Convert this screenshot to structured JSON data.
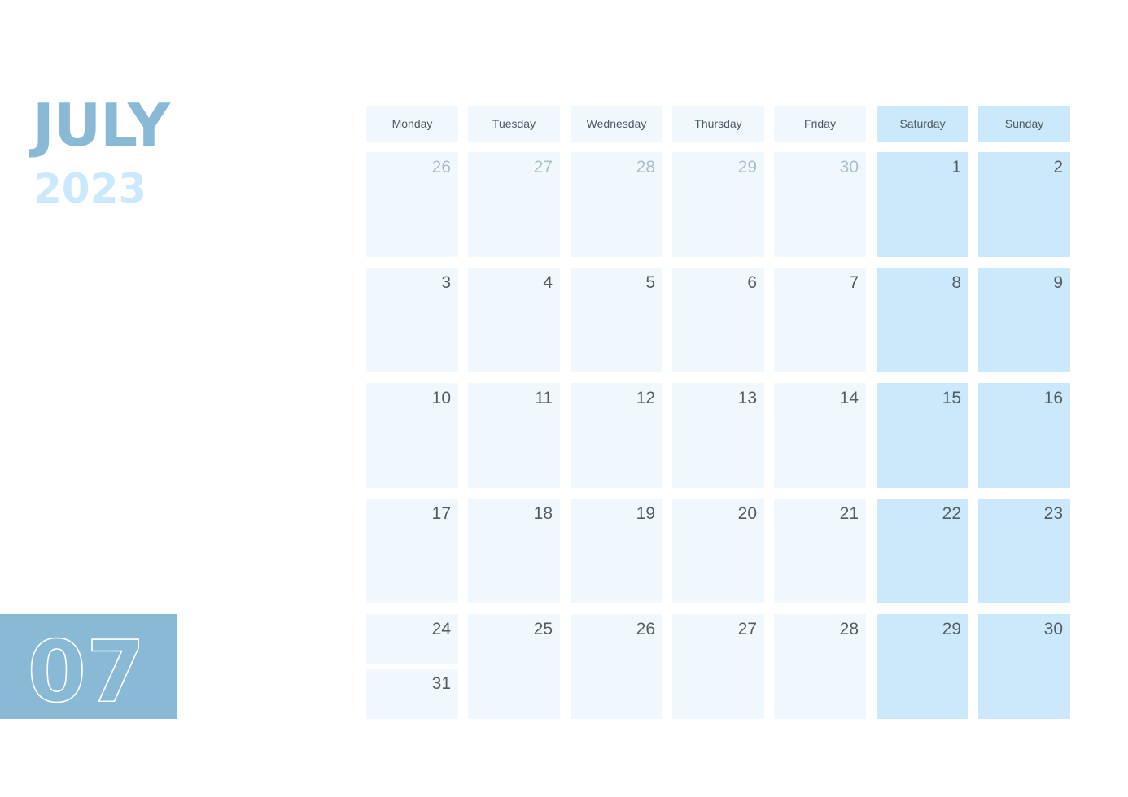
{
  "calendar": {
    "month_name": "JULY",
    "year": "2023",
    "month_number": "07",
    "colors": {
      "title": "#8ab9d6",
      "year": "#cbe9fa",
      "weekday_cell": "#f1f8fd",
      "weekend_cell": "#cbe9fa",
      "month_box": "#8ab9d6",
      "day_number": "#555c61",
      "outside_day_number": "#a9bec8"
    },
    "weekdays": [
      {
        "label": "Monday",
        "weekend": false
      },
      {
        "label": "Tuesday",
        "weekend": false
      },
      {
        "label": "Wednesday",
        "weekend": false
      },
      {
        "label": "Thursday",
        "weekend": false
      },
      {
        "label": "Friday",
        "weekend": false
      },
      {
        "label": "Saturday",
        "weekend": true
      },
      {
        "label": "Sunday",
        "weekend": true
      }
    ],
    "weeks": [
      [
        {
          "day": "26",
          "outside": true
        },
        {
          "day": "27",
          "outside": true
        },
        {
          "day": "28",
          "outside": true
        },
        {
          "day": "29",
          "outside": true
        },
        {
          "day": "30",
          "outside": true
        },
        {
          "day": "1"
        },
        {
          "day": "2"
        }
      ],
      [
        {
          "day": "3"
        },
        {
          "day": "4"
        },
        {
          "day": "5"
        },
        {
          "day": "6"
        },
        {
          "day": "7"
        },
        {
          "day": "8"
        },
        {
          "day": "9"
        }
      ],
      [
        {
          "day": "10"
        },
        {
          "day": "11"
        },
        {
          "day": "12"
        },
        {
          "day": "13"
        },
        {
          "day": "14"
        },
        {
          "day": "15"
        },
        {
          "day": "16"
        }
      ],
      [
        {
          "day": "17"
        },
        {
          "day": "18"
        },
        {
          "day": "19"
        },
        {
          "day": "20"
        },
        {
          "day": "21"
        },
        {
          "day": "22"
        },
        {
          "day": "23"
        }
      ],
      [
        {
          "day": "24",
          "split_with": "31"
        },
        {
          "day": "25"
        },
        {
          "day": "26"
        },
        {
          "day": "27"
        },
        {
          "day": "28"
        },
        {
          "day": "29"
        },
        {
          "day": "30"
        }
      ]
    ]
  }
}
